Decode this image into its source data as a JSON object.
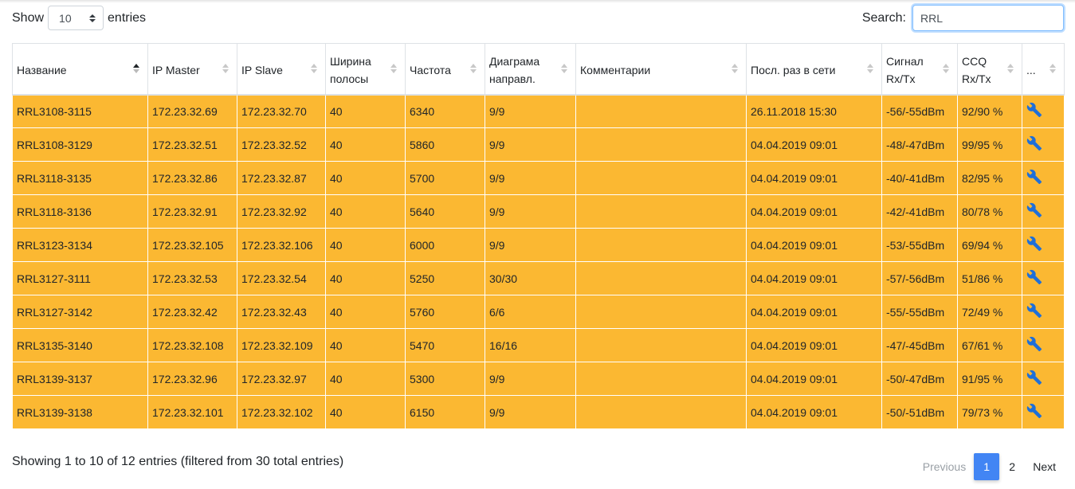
{
  "length": {
    "show_label": "Show",
    "value": "10",
    "entries_label": "entries"
  },
  "search": {
    "label": "Search:",
    "value": "RRL"
  },
  "table": {
    "headers": [
      {
        "label": "Название",
        "sorted": "asc"
      },
      {
        "label": "IP Master"
      },
      {
        "label": "IP Slave"
      },
      {
        "label": "Ширина полосы"
      },
      {
        "label": "Частота"
      },
      {
        "label": "Диаграма направл."
      },
      {
        "label": "Комментарии"
      },
      {
        "label": "Посл. раз в сети"
      },
      {
        "label": "Сигнал Rx/Tx"
      },
      {
        "label": "CCQ Rx/Tx"
      },
      {
        "label": "..."
      }
    ],
    "row_color": "#fbb832",
    "action_icon": "wrench-icon",
    "rows": [
      [
        "RRL3108-3115",
        "172.23.32.69",
        "172.23.32.70",
        "40",
        "6340",
        "9/9",
        "",
        "26.11.2018 15:30",
        "-56/-55dBm",
        "92/90 %"
      ],
      [
        "RRL3108-3129",
        "172.23.32.51",
        "172.23.32.52",
        "40",
        "5860",
        "9/9",
        "",
        "04.04.2019 09:01",
        "-48/-47dBm",
        "99/95 %"
      ],
      [
        "RRL3118-3135",
        "172.23.32.86",
        "172.23.32.87",
        "40",
        "5700",
        "9/9",
        "",
        "04.04.2019 09:01",
        "-40/-41dBm",
        "82/95 %"
      ],
      [
        "RRL3118-3136",
        "172.23.32.91",
        "172.23.32.92",
        "40",
        "5640",
        "9/9",
        "",
        "04.04.2019 09:01",
        "-42/-41dBm",
        "80/78 %"
      ],
      [
        "RRL3123-3134",
        "172.23.32.105",
        "172.23.32.106",
        "40",
        "6000",
        "9/9",
        "",
        "04.04.2019 09:01",
        "-53/-55dBm",
        "69/94 %"
      ],
      [
        "RRL3127-3111",
        "172.23.32.53",
        "172.23.32.54",
        "40",
        "5250",
        "30/30",
        "",
        "04.04.2019 09:01",
        "-57/-56dBm",
        "51/86 %"
      ],
      [
        "RRL3127-3142",
        "172.23.32.42",
        "172.23.32.43",
        "40",
        "5760",
        "6/6",
        "",
        "04.04.2019 09:01",
        "-55/-55dBm",
        "72/49 %"
      ],
      [
        "RRL3135-3140",
        "172.23.32.108",
        "172.23.32.109",
        "40",
        "5470",
        "16/16",
        "",
        "04.04.2019 09:01",
        "-47/-45dBm",
        "67/61 %"
      ],
      [
        "RRL3139-3137",
        "172.23.32.96",
        "172.23.32.97",
        "40",
        "5300",
        "9/9",
        "",
        "04.04.2019 09:01",
        "-50/-47dBm",
        "91/95 %"
      ],
      [
        "RRL3139-3138",
        "172.23.32.101",
        "172.23.32.102",
        "40",
        "6150",
        "9/9",
        "",
        "04.04.2019 09:01",
        "-50/-51dBm",
        "79/73 %"
      ]
    ]
  },
  "footer": {
    "info": "Showing 1 to 10 of 12 entries (filtered from 30 total entries)",
    "previous": "Previous",
    "pages": [
      "1",
      "2"
    ],
    "active_page": "1",
    "next": "Next",
    "accent_color": "#4285f4"
  }
}
